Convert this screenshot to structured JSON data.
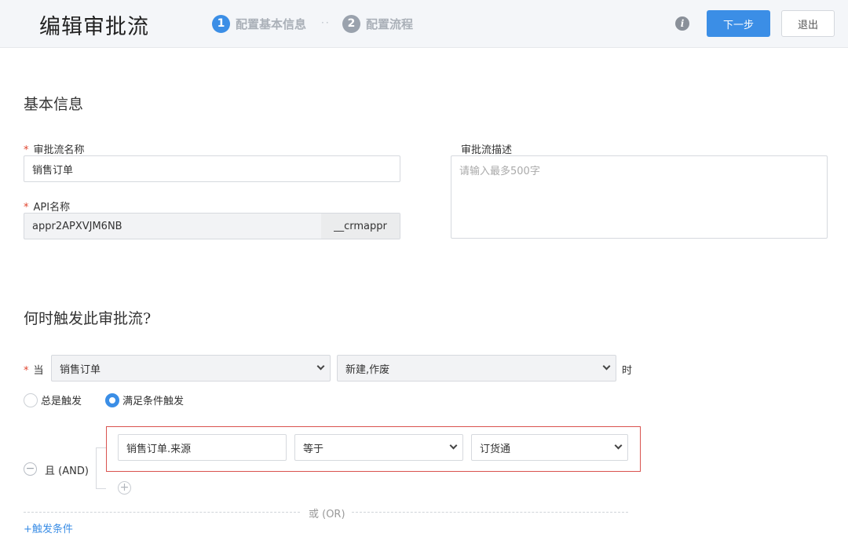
{
  "header": {
    "title": "编辑审批流",
    "steps": [
      {
        "num": "1",
        "label": "配置基本信息"
      },
      {
        "num": "2",
        "label": "配置流程"
      }
    ],
    "info_icon": "i",
    "next_label": "下一步",
    "exit_label": "退出",
    "step_dots": "··"
  },
  "basic": {
    "title": "基本信息",
    "required_mark": "*",
    "name_label": "审批流名称",
    "name_value": "销售订单",
    "api_label": "API名称",
    "api_value": "appr2APXVJM6NB",
    "api_suffix": "__crmappr",
    "desc_label": "审批流描述",
    "desc_placeholder": "请输入最多500字"
  },
  "trigger": {
    "title": "何时触发此审批流?",
    "required_mark": "*",
    "when_label": "当",
    "object_value": "销售订单",
    "event_value": "新建,作废",
    "time_label": "时",
    "radio_always": "总是触发",
    "radio_condition": "满足条件触发",
    "selected_radio": "满足条件触发",
    "and_label": "且 (AND)",
    "condition": {
      "field": "销售订单.来源",
      "operator": "等于",
      "value": "订货通"
    },
    "minus_glyph": "−",
    "plus_glyph": "+",
    "or_label": "或 (OR)",
    "add_condition": "+触发条件"
  }
}
